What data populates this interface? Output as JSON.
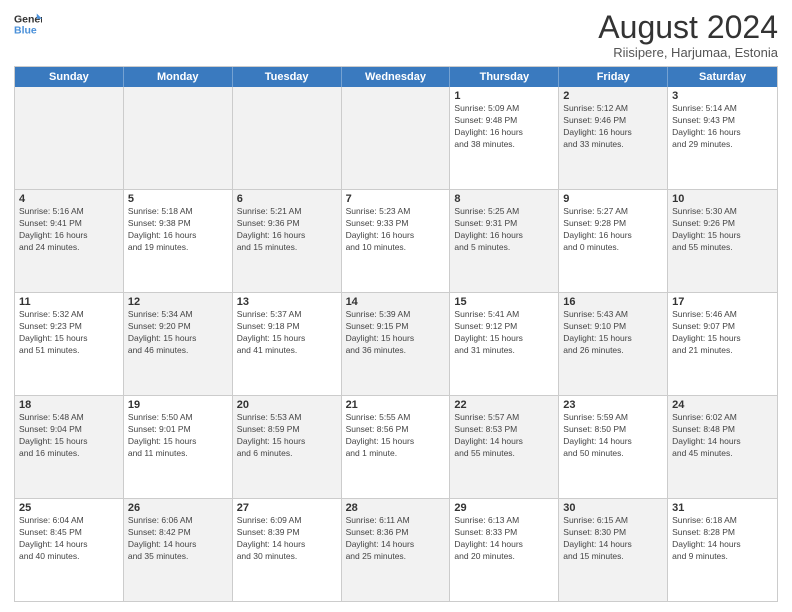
{
  "logo": {
    "line1": "General",
    "line2": "Blue"
  },
  "title": "August 2024",
  "subtitle": "Riisipere, Harjumaa, Estonia",
  "header_days": [
    "Sunday",
    "Monday",
    "Tuesday",
    "Wednesday",
    "Thursday",
    "Friday",
    "Saturday"
  ],
  "rows": [
    [
      {
        "day": "",
        "info": "",
        "shade": true
      },
      {
        "day": "",
        "info": "",
        "shade": true
      },
      {
        "day": "",
        "info": "",
        "shade": true
      },
      {
        "day": "",
        "info": "",
        "shade": true
      },
      {
        "day": "1",
        "info": "Sunrise: 5:09 AM\nSunset: 9:48 PM\nDaylight: 16 hours\nand 38 minutes."
      },
      {
        "day": "2",
        "info": "Sunrise: 5:12 AM\nSunset: 9:46 PM\nDaylight: 16 hours\nand 33 minutes.",
        "shade": true
      },
      {
        "day": "3",
        "info": "Sunrise: 5:14 AM\nSunset: 9:43 PM\nDaylight: 16 hours\nand 29 minutes."
      }
    ],
    [
      {
        "day": "4",
        "info": "Sunrise: 5:16 AM\nSunset: 9:41 PM\nDaylight: 16 hours\nand 24 minutes.",
        "shade": true
      },
      {
        "day": "5",
        "info": "Sunrise: 5:18 AM\nSunset: 9:38 PM\nDaylight: 16 hours\nand 19 minutes."
      },
      {
        "day": "6",
        "info": "Sunrise: 5:21 AM\nSunset: 9:36 PM\nDaylight: 16 hours\nand 15 minutes.",
        "shade": true
      },
      {
        "day": "7",
        "info": "Sunrise: 5:23 AM\nSunset: 9:33 PM\nDaylight: 16 hours\nand 10 minutes."
      },
      {
        "day": "8",
        "info": "Sunrise: 5:25 AM\nSunset: 9:31 PM\nDaylight: 16 hours\nand 5 minutes.",
        "shade": true
      },
      {
        "day": "9",
        "info": "Sunrise: 5:27 AM\nSunset: 9:28 PM\nDaylight: 16 hours\nand 0 minutes."
      },
      {
        "day": "10",
        "info": "Sunrise: 5:30 AM\nSunset: 9:26 PM\nDaylight: 15 hours\nand 55 minutes.",
        "shade": true
      }
    ],
    [
      {
        "day": "11",
        "info": "Sunrise: 5:32 AM\nSunset: 9:23 PM\nDaylight: 15 hours\nand 51 minutes."
      },
      {
        "day": "12",
        "info": "Sunrise: 5:34 AM\nSunset: 9:20 PM\nDaylight: 15 hours\nand 46 minutes.",
        "shade": true
      },
      {
        "day": "13",
        "info": "Sunrise: 5:37 AM\nSunset: 9:18 PM\nDaylight: 15 hours\nand 41 minutes."
      },
      {
        "day": "14",
        "info": "Sunrise: 5:39 AM\nSunset: 9:15 PM\nDaylight: 15 hours\nand 36 minutes.",
        "shade": true
      },
      {
        "day": "15",
        "info": "Sunrise: 5:41 AM\nSunset: 9:12 PM\nDaylight: 15 hours\nand 31 minutes."
      },
      {
        "day": "16",
        "info": "Sunrise: 5:43 AM\nSunset: 9:10 PM\nDaylight: 15 hours\nand 26 minutes.",
        "shade": true
      },
      {
        "day": "17",
        "info": "Sunrise: 5:46 AM\nSunset: 9:07 PM\nDaylight: 15 hours\nand 21 minutes."
      }
    ],
    [
      {
        "day": "18",
        "info": "Sunrise: 5:48 AM\nSunset: 9:04 PM\nDaylight: 15 hours\nand 16 minutes.",
        "shade": true
      },
      {
        "day": "19",
        "info": "Sunrise: 5:50 AM\nSunset: 9:01 PM\nDaylight: 15 hours\nand 11 minutes."
      },
      {
        "day": "20",
        "info": "Sunrise: 5:53 AM\nSunset: 8:59 PM\nDaylight: 15 hours\nand 6 minutes.",
        "shade": true
      },
      {
        "day": "21",
        "info": "Sunrise: 5:55 AM\nSunset: 8:56 PM\nDaylight: 15 hours\nand 1 minute."
      },
      {
        "day": "22",
        "info": "Sunrise: 5:57 AM\nSunset: 8:53 PM\nDaylight: 14 hours\nand 55 minutes.",
        "shade": true
      },
      {
        "day": "23",
        "info": "Sunrise: 5:59 AM\nSunset: 8:50 PM\nDaylight: 14 hours\nand 50 minutes."
      },
      {
        "day": "24",
        "info": "Sunrise: 6:02 AM\nSunset: 8:48 PM\nDaylight: 14 hours\nand 45 minutes.",
        "shade": true
      }
    ],
    [
      {
        "day": "25",
        "info": "Sunrise: 6:04 AM\nSunset: 8:45 PM\nDaylight: 14 hours\nand 40 minutes."
      },
      {
        "day": "26",
        "info": "Sunrise: 6:06 AM\nSunset: 8:42 PM\nDaylight: 14 hours\nand 35 minutes.",
        "shade": true
      },
      {
        "day": "27",
        "info": "Sunrise: 6:09 AM\nSunset: 8:39 PM\nDaylight: 14 hours\nand 30 minutes."
      },
      {
        "day": "28",
        "info": "Sunrise: 6:11 AM\nSunset: 8:36 PM\nDaylight: 14 hours\nand 25 minutes.",
        "shade": true
      },
      {
        "day": "29",
        "info": "Sunrise: 6:13 AM\nSunset: 8:33 PM\nDaylight: 14 hours\nand 20 minutes."
      },
      {
        "day": "30",
        "info": "Sunrise: 6:15 AM\nSunset: 8:30 PM\nDaylight: 14 hours\nand 15 minutes.",
        "shade": true
      },
      {
        "day": "31",
        "info": "Sunrise: 6:18 AM\nSunset: 8:28 PM\nDaylight: 14 hours\nand 9 minutes."
      }
    ]
  ]
}
